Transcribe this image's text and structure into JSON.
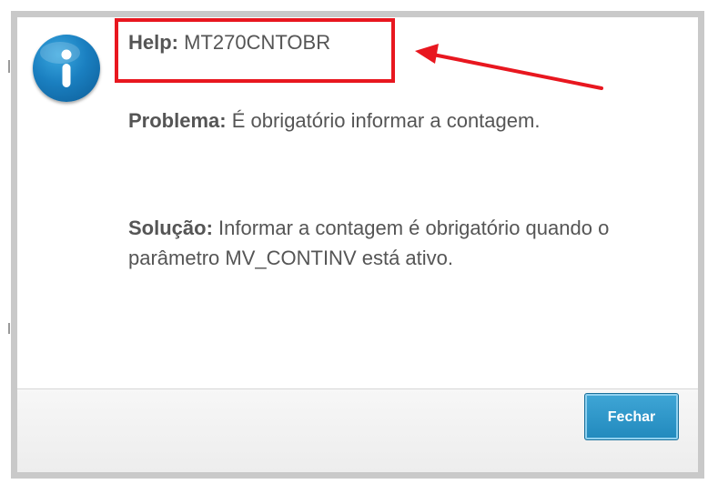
{
  "help": {
    "label": "Help:",
    "code": "MT270CNTOBR"
  },
  "problem": {
    "label": "Problema:",
    "text": "É obrigatório informar a contagem."
  },
  "solution": {
    "label": "Solução:",
    "text": "Informar a contagem é obrigatório quando o parâmetro MV_CONTINV está ativo."
  },
  "footer": {
    "close_label": "Fechar"
  },
  "icons": {
    "dialog_icon": "info-icon"
  },
  "colors": {
    "highlight": "#e8171f",
    "button": "#2a93c6",
    "icon": "#1a7fc0",
    "text": "#555555"
  }
}
